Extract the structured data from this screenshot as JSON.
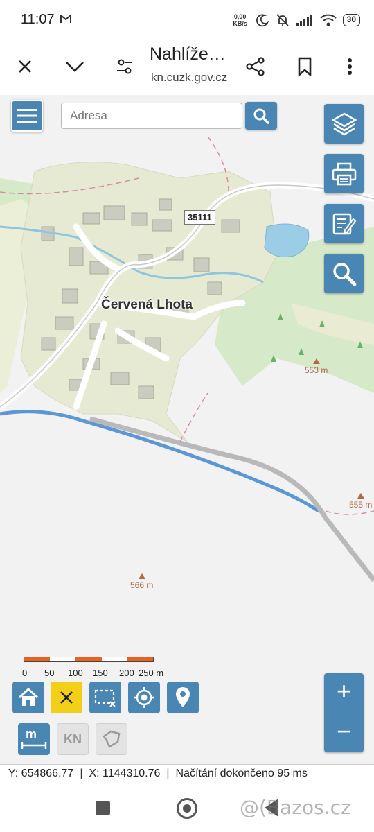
{
  "status_bar": {
    "time": "11:07",
    "net_speed_value": "0,00",
    "net_speed_unit": "KB/s",
    "battery": "30"
  },
  "browser": {
    "title": "Nahlíže…",
    "url": "kn.cuzk.gov.cz",
    "icons": [
      "close-icon",
      "chevron-down-icon",
      "settings-sliders-icon",
      "share-icon",
      "bookmark-icon",
      "more-vert-icon"
    ]
  },
  "map": {
    "search_placeholder": "Adresa",
    "place_name": "Červená Lhota",
    "road_number": "35111",
    "elevations": [
      {
        "label": "553 m"
      },
      {
        "label": "555 m"
      },
      {
        "label": "566 m"
      }
    ],
    "scale": {
      "labels": [
        "0",
        "50",
        "100",
        "150",
        "200",
        "250 m"
      ],
      "colors": [
        "#e8641e",
        "#ffffff",
        "#e8641e",
        "#ffffff",
        "#e8641e"
      ]
    },
    "tools": {
      "layers": "layers-icon",
      "print": "printer-icon",
      "report": "edit-document-icon",
      "search": "magnifier-icon",
      "home": "home-icon",
      "clear": "close-icon",
      "select": "select-area-icon",
      "locate": "crosshair-icon",
      "marker": "map-pin-icon",
      "measure": "measure-icon",
      "kn_label": "KN",
      "shape": "polygon-icon"
    },
    "zoom_in": "+",
    "zoom_out": "−"
  },
  "coordinates": {
    "y": "Y: 654866.77",
    "x": "X: 1144310.76",
    "status": "Načítání dokončeno 95 ms",
    "separator": "|"
  },
  "nav": {
    "watermark": "@(Bazos.cz"
  },
  "colors": {
    "button_blue": "#4a86b4",
    "active_yellow": "#f3d017",
    "village": "#e6ead2",
    "forest": "#cfe5c1",
    "water": "#9ccde6"
  }
}
